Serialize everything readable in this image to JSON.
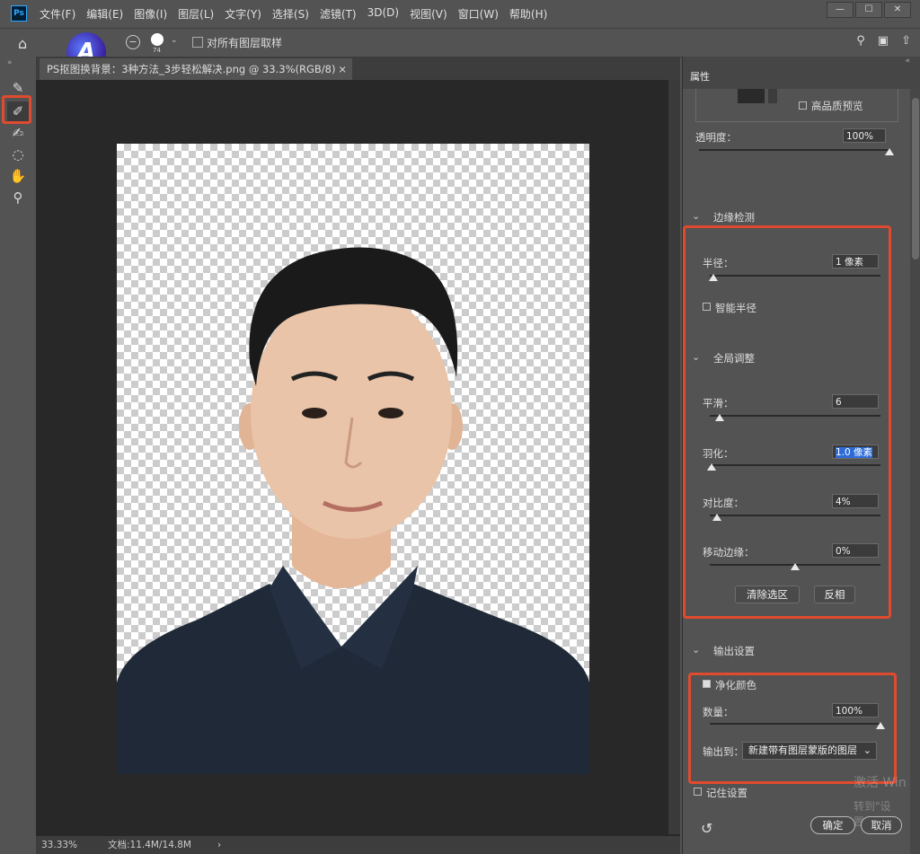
{
  "app": {
    "logo": "Ps"
  },
  "menu": [
    "文件(F)",
    "编辑(E)",
    "图像(I)",
    "图层(L)",
    "文字(Y)",
    "选择(S)",
    "滤镜(T)",
    "3D(D)",
    "视图(V)",
    "窗口(W)",
    "帮助(H)"
  ],
  "window_buttons": [
    "—",
    "☐",
    "✕"
  ],
  "options": {
    "brush_size": "74",
    "sample_all_layers": "对所有图层取样",
    "minus": "−"
  },
  "badge_letter": "A",
  "document": {
    "tab_title": "PS抠图换背景：3种方法_3步轻松解决.png @ 33.3%(RGB/8)",
    "tab_close": "×",
    "zoom": "33.33%",
    "doc_info": "文档:11.4M/14.8M",
    "status_arrow": "›"
  },
  "panel": {
    "tab": "属性",
    "high_quality_preview": "高品质预览",
    "opacity_label": "透明度：",
    "opacity_value": "100%",
    "opacity_fraction": 1.0,
    "edge_detection": {
      "title": "边缘检测",
      "radius_label": "半径：",
      "radius_value": "1 像素",
      "radius_fraction": 0.02,
      "smart_radius": "智能半径"
    },
    "global_refine": {
      "title": "全局调整",
      "smooth_label": "平滑：",
      "smooth_value": "6",
      "smooth_fraction": 0.06,
      "feather_label": "羽化：",
      "feather_value": "1.0 像素",
      "feather_fraction": 0.01,
      "contrast_label": "对比度：",
      "contrast_value": "4%",
      "contrast_fraction": 0.04,
      "shift_edge_label": "移动边缘：",
      "shift_edge_value": "0%",
      "shift_edge_fraction": 0.5,
      "clear_selection": "清除选区",
      "invert": "反相"
    },
    "output": {
      "title": "输出设置",
      "decontaminate": "净化颜色",
      "amount_label": "数量：",
      "amount_value": "100%",
      "amount_fraction": 1.0,
      "output_to_label": "输出到：",
      "output_to_value": "新建带有图层蒙版的图层",
      "remember": "记住设置"
    },
    "ok": "确定",
    "cancel": "取消"
  },
  "watermark": {
    "line1": "激活 Win",
    "line2": "转到\"设置\"以"
  },
  "colors": {
    "highlight": "#e04b2f",
    "shirt": "#1f2937",
    "hair": "#1a1a1a",
    "skin": "#e9c4a8"
  }
}
